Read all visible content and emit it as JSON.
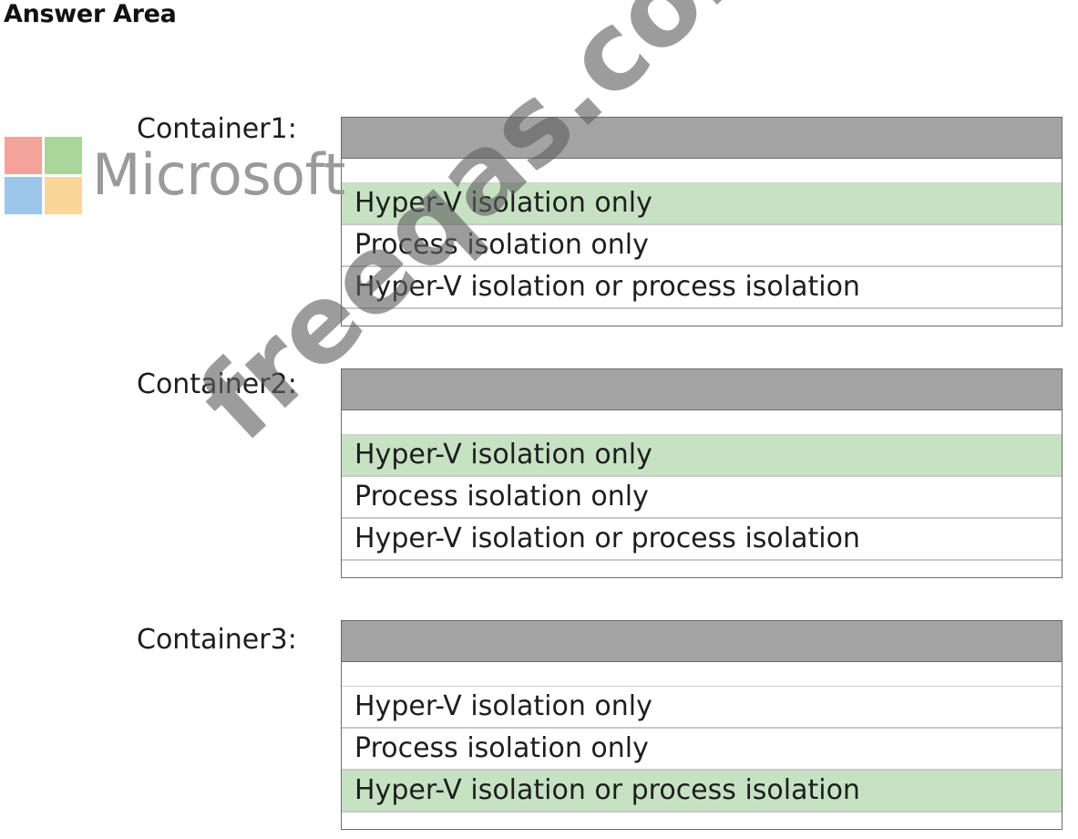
{
  "title": "Answer Area",
  "watermark_logo": {
    "text": "Microsoft",
    "colors": [
      "#f2a39a",
      "#a9d69a",
      "#9cc7ea",
      "#fbd69a"
    ]
  },
  "watermark_text": "freeqas.com",
  "containers": [
    {
      "label": "Container1:",
      "options": [
        "Hyper-V isolation only",
        "Process isolation only",
        "Hyper-V isolation or process isolation"
      ],
      "selected_index": 0
    },
    {
      "label": "Container2:",
      "options": [
        "Hyper-V isolation only",
        "Process isolation only",
        "Hyper-V isolation or process isolation"
      ],
      "selected_index": 0
    },
    {
      "label": "Container3:",
      "options": [
        "Hyper-V isolation only",
        "Process isolation only",
        "Hyper-V isolation or process isolation"
      ],
      "selected_index": 2
    }
  ],
  "colors": {
    "selected_highlight": "#c6e2c3",
    "header_gray": "#a3a3a3"
  }
}
